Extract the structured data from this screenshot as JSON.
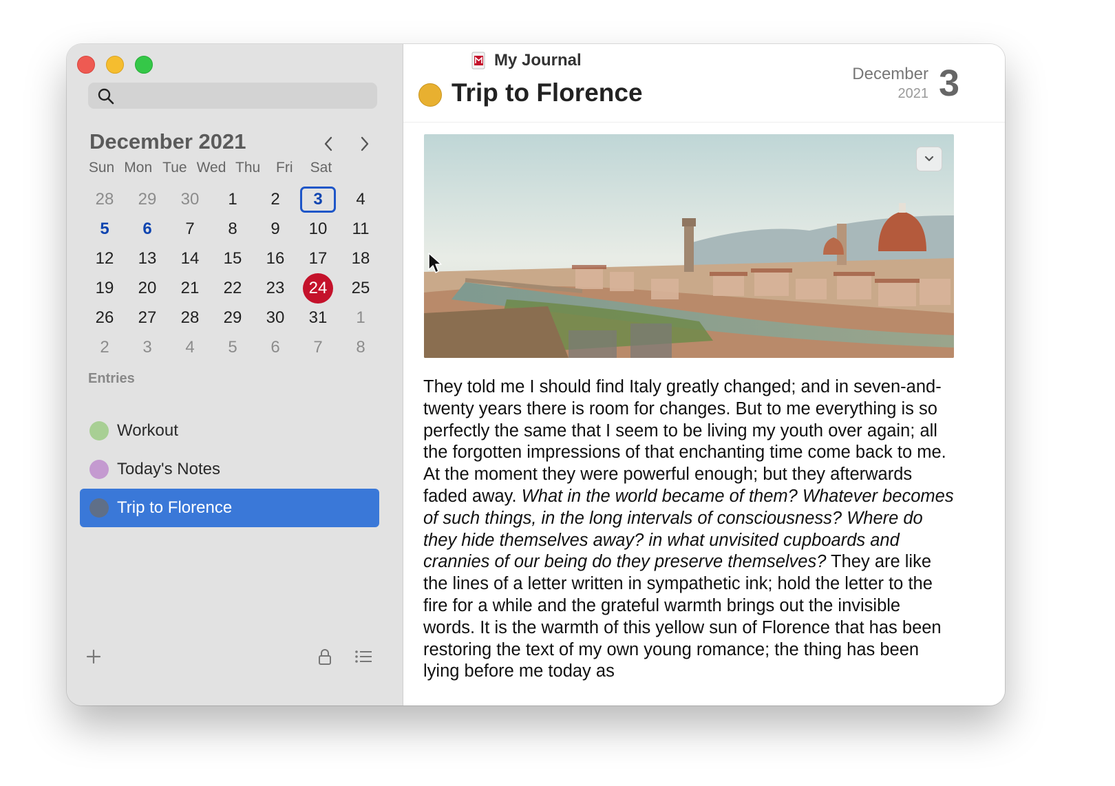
{
  "window": {
    "journal_name": "My Journal"
  },
  "search": {
    "placeholder": ""
  },
  "calendar": {
    "month_title": "December 2021",
    "weekdays": [
      "Sun",
      "Mon",
      "Tue",
      "Wed",
      "Thu",
      "Fri",
      "Sat"
    ],
    "days": [
      {
        "n": "28",
        "out": true
      },
      {
        "n": "29",
        "out": true
      },
      {
        "n": "30",
        "out": true
      },
      {
        "n": "1"
      },
      {
        "n": "2"
      },
      {
        "n": "3",
        "selected": true
      },
      {
        "n": "4"
      },
      {
        "n": "5",
        "entry": true
      },
      {
        "n": "6",
        "entry": true
      },
      {
        "n": "7"
      },
      {
        "n": "8"
      },
      {
        "n": "9"
      },
      {
        "n": "10"
      },
      {
        "n": "11"
      },
      {
        "n": "12"
      },
      {
        "n": "13"
      },
      {
        "n": "14"
      },
      {
        "n": "15"
      },
      {
        "n": "16"
      },
      {
        "n": "17"
      },
      {
        "n": "18"
      },
      {
        "n": "19"
      },
      {
        "n": "20"
      },
      {
        "n": "21"
      },
      {
        "n": "22"
      },
      {
        "n": "23"
      },
      {
        "n": "24",
        "today": true
      },
      {
        "n": "25"
      },
      {
        "n": "26"
      },
      {
        "n": "27"
      },
      {
        "n": "28"
      },
      {
        "n": "29"
      },
      {
        "n": "30"
      },
      {
        "n": "31"
      },
      {
        "n": "1",
        "out": true
      },
      {
        "n": "2",
        "out": true
      },
      {
        "n": "3",
        "out": true
      },
      {
        "n": "4",
        "out": true
      },
      {
        "n": "5",
        "out": true
      },
      {
        "n": "6",
        "out": true
      },
      {
        "n": "7",
        "out": true
      },
      {
        "n": "8",
        "out": true
      }
    ]
  },
  "entries": {
    "label": "Entries",
    "items": [
      {
        "label": "Workout",
        "color": "#a8cf94"
      },
      {
        "label": "Today's Notes",
        "color": "#c49ad0"
      },
      {
        "label": "Trip to Florence",
        "color": "#5f6f88",
        "active": true
      }
    ]
  },
  "entry": {
    "title": "Trip to Florence",
    "dot_color": "#e8b030",
    "date_month": "December",
    "date_year": "2021",
    "date_day": "3",
    "body_p1": "They told me I should find Italy greatly changed; and in seven-and-twenty years there is room for changes.  But to me everything is so perfectly the same that I seem to be living my youth over again; all the forgotten impressions of that enchanting time come back to me.  At the moment they were powerful enough; but they afterwards faded away.  ",
    "body_italic": "What in the world became of them? Whatever becomes of such things, in the long intervals of consciousness?  Where do they hide themselves away? in what unvisited cupboards and crannies of our being do they preserve themselves?",
    "body_p2": "  They are like the lines of a letter written in sympathetic ink; hold the letter to the fire for a while and the grateful warmth brings out the invisible words.  It is the warmth of this yellow sun of Florence that has been restoring the text of my own young romance; the thing has been lying before me today as"
  },
  "icons": {
    "search": "magnifying-glass-icon",
    "prev": "chevron-left-icon",
    "next": "chevron-right-icon",
    "add": "plus-icon",
    "lock": "lock-icon",
    "list": "list-icon",
    "journal": "journal-book-icon",
    "photo_menu": "chevron-down-icon"
  },
  "colors": {
    "accent": "#3a78d8",
    "today": "#c4122b",
    "selected_border": "#1e56c8",
    "sidebar_bg": "#e2e2e2"
  }
}
